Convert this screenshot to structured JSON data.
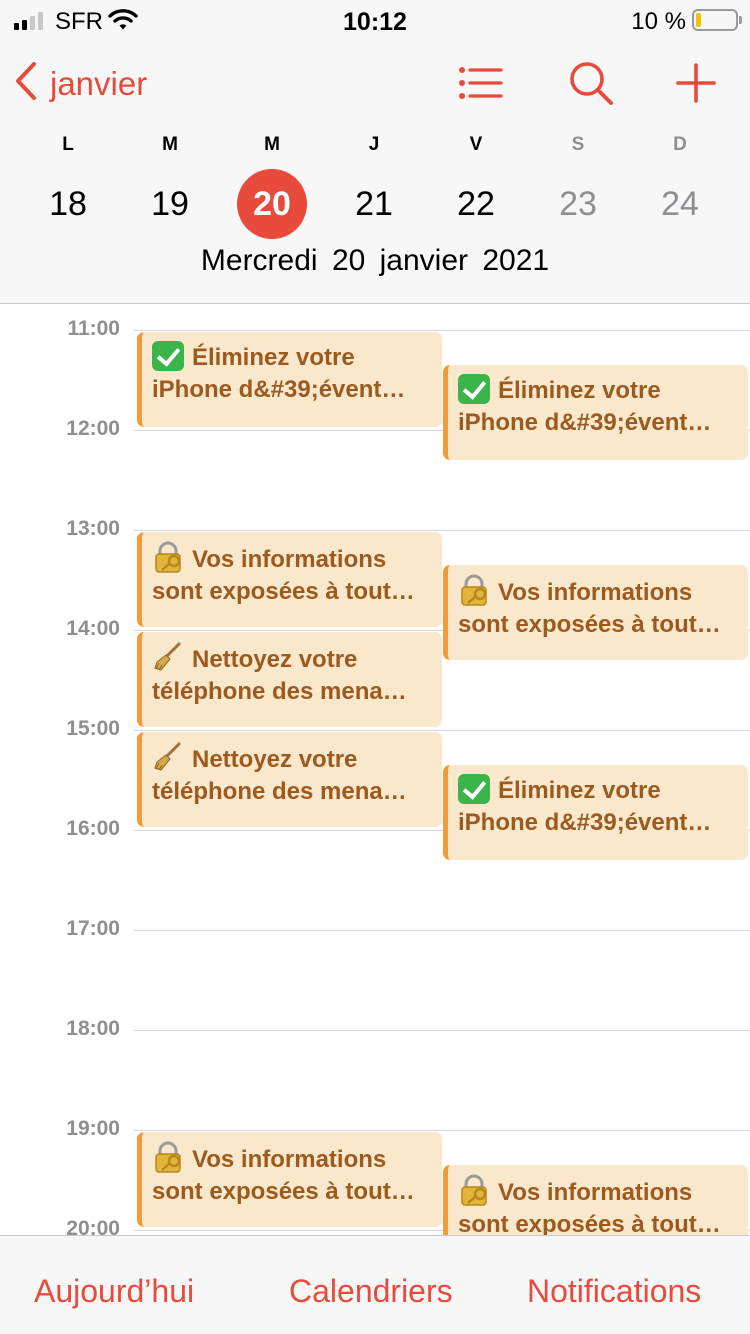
{
  "status_bar": {
    "carrier": "SFR",
    "time": "10:12",
    "battery_percent": "10 %",
    "battery_level": 0.1,
    "signal_bars": 2
  },
  "header": {
    "back_label": "janvier",
    "icons": [
      "chevron-left-icon",
      "list-icon",
      "search-icon",
      "plus-icon"
    ],
    "accent_color": "#e84b3c",
    "weekdays": [
      "L",
      "M",
      "M",
      "J",
      "V",
      "S",
      "D"
    ],
    "days": [
      "18",
      "19",
      "20",
      "21",
      "22",
      "23",
      "24"
    ],
    "selected_index": 2,
    "weekday_name": "Mercredi",
    "date_text": "20 janvier 2021"
  },
  "timeline": {
    "hours": [
      "11:00",
      "12:00",
      "13:00",
      "14:00",
      "15:00",
      "16:00",
      "17:00",
      "18:00",
      "19:00",
      "20:00"
    ],
    "event_colors": {
      "background": "#fae8cd",
      "border": "#f29b38",
      "text": "#9c5a1e"
    },
    "events": [
      {
        "icon": "check-icon",
        "line1": "Éliminez votre",
        "line2": "iPhone d&#39;évent…",
        "column": 0,
        "start": "11:00",
        "end": "12:00"
      },
      {
        "icon": "check-icon",
        "line1": "Éliminez votre",
        "line2": "iPhone d&#39;évent…",
        "column": 1,
        "start": "11:20",
        "end": "12:20"
      },
      {
        "icon": "lock-icon",
        "line1": "Vos informations",
        "line2": "sont exposées à tout…",
        "column": 0,
        "start": "13:00",
        "end": "14:00"
      },
      {
        "icon": "lock-icon",
        "line1": "Vos informations",
        "line2": "sont exposées à tout…",
        "column": 1,
        "start": "13:20",
        "end": "14:20"
      },
      {
        "icon": "broom-icon",
        "line1": "Nettoyez votre",
        "line2": "téléphone des mena…",
        "column": 0,
        "start": "14:00",
        "end": "15:00"
      },
      {
        "icon": "broom-icon",
        "line1": "Nettoyez votre",
        "line2": "téléphone des mena…",
        "column": 0,
        "start": "15:00",
        "end": "16:00"
      },
      {
        "icon": "check-icon",
        "line1": "Éliminez votre",
        "line2": "iPhone d&#39;évent…",
        "column": 1,
        "start": "15:20",
        "end": "16:20"
      },
      {
        "icon": "lock-icon",
        "line1": "Vos informations",
        "line2": "sont exposées à tout…",
        "column": 0,
        "start": "19:00",
        "end": "20:00"
      },
      {
        "icon": "lock-icon",
        "line1": "Vos informations",
        "line2": "sont exposées à tout…",
        "column": 1,
        "start": "19:20",
        "end": "20:20"
      }
    ]
  },
  "tab_bar": {
    "today": "Aujourd’hui",
    "calendars": "Calendriers",
    "inbox": "Notifications"
  }
}
